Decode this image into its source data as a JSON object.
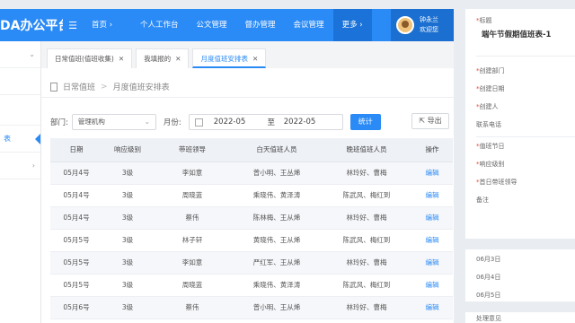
{
  "app": {
    "title": "DA办公平台",
    "nav": [
      "首页",
      "个人工作台",
      "公文管理",
      "督办管理",
      "会议管理",
      "更多"
    ],
    "user": {
      "name": "钟永兰",
      "greeting": "欢迎您"
    }
  },
  "sidebar": {
    "items": [
      "",
      "",
      "表",
      ""
    ]
  },
  "tabs": [
    {
      "label": "日常值班(值班收集)"
    },
    {
      "label": "我填报的"
    },
    {
      "label": "月度值班安排表"
    }
  ],
  "breadcrumb": {
    "root": "日常值班",
    "current": "月度值班安排表"
  },
  "filters": {
    "dept_label": "部门:",
    "dept_value": "管理机构",
    "month_label": "月份:",
    "month_from": "2022-05",
    "to": "至",
    "month_to": "2022-05",
    "stats_button": "统计",
    "export_button": "导出"
  },
  "table": {
    "columns": [
      "日期",
      "响应级别",
      "带班领导",
      "白天值班人员",
      "晚班值班人员",
      "操作"
    ],
    "rows": [
      [
        "05月4号",
        "3级",
        "李如意",
        "曾小明、王丛烯",
        "林玲好、曹梅",
        "编辑"
      ],
      [
        "05月4号",
        "3级",
        "周晓蓝",
        "乘晓伟、黄泽涛",
        "陈武风、梅红到",
        "编辑"
      ],
      [
        "05月4号",
        "3级",
        "蔡伟",
        "陈林梅、王从烯",
        "林玲好、曹梅",
        "编辑"
      ],
      [
        "05月5号",
        "3级",
        "林子轩",
        "黄晓伟、王从烯",
        "陈武风、梅红到",
        "编辑"
      ],
      [
        "05月5号",
        "3级",
        "李如意",
        "严红军、王从烯",
        "林玲好、曹梅",
        "编辑"
      ],
      [
        "05月5号",
        "3级",
        "周晓蓝",
        "乘晓伟、黄泽涛",
        "陈武风、梅红到",
        "编辑"
      ],
      [
        "05月6号",
        "3级",
        "蔡伟",
        "曾小明、王从烯",
        "林玲好、曹梅",
        "编辑"
      ]
    ]
  },
  "panel": {
    "title_label": "标题",
    "title_value": "端午节假期值班表-1",
    "fields": [
      "创建部门",
      "创建日期",
      "创建人",
      "联系电话",
      "值班节日",
      "响应级别",
      "首日带班领导",
      "备注"
    ],
    "dates": [
      "06月3日",
      "06月4日",
      "06月5日"
    ],
    "footer_label": "处理意见"
  },
  "colors": {
    "primary": "#2a8af6",
    "header_bg": "#2a8af6"
  }
}
